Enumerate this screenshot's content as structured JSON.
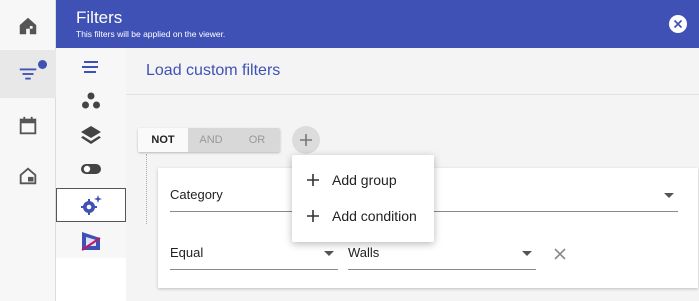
{
  "colors": {
    "primary": "#3f51b5",
    "rail": "#f7f7f7",
    "panel": "#f4f4f4"
  },
  "rail": {
    "items": [
      {
        "icon": "home-icon"
      },
      {
        "icon": "filter-icon",
        "active": true,
        "badge": true
      },
      {
        "icon": "calendar-icon"
      },
      {
        "icon": "house-outline-icon"
      }
    ]
  },
  "header": {
    "title": "Filters",
    "subtitle": "This filters will be applied on the viewer."
  },
  "subrail": {
    "items": [
      {
        "icon": "lines-icon"
      },
      {
        "icon": "dots-cluster-icon"
      },
      {
        "icon": "layers-icon"
      },
      {
        "icon": "toggle-icon"
      },
      {
        "icon": "gear-sparkle-icon",
        "selected": true
      },
      {
        "icon": "section-box-icon"
      }
    ]
  },
  "main": {
    "load_custom_filters": "Load custom filters",
    "logic": {
      "not": "NOT",
      "and": "AND",
      "or": "OR"
    },
    "condition": {
      "category_value": "Category",
      "operator_value": "Equal",
      "value_value": "Walls"
    },
    "menu": {
      "add_group": "Add group",
      "add_condition": "Add condition"
    }
  }
}
